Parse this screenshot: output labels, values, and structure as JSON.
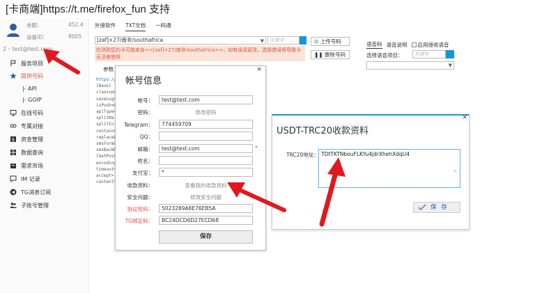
{
  "title": {
    "bracket_open": "[",
    "app_name": "卡商端",
    "bracket_close": "]",
    "url": "https://t.me/firefox_fun",
    "suffix": " 支持"
  },
  "sidebar": {
    "balance_label": "余额：",
    "balance_value": "452.4",
    "device_label": "设备ID：",
    "device_value": "8005",
    "account": "2 - test@test.com",
    "items": [
      {
        "label": "服务项目",
        "icon": "flag-icon"
      },
      {
        "label": "提供号码",
        "icon": "star-icon"
      },
      {
        "label": "在线号码",
        "icon": "screen-icon"
      },
      {
        "label": "专属对接",
        "icon": "link-icon"
      },
      {
        "label": "资金管理",
        "icon": "money-icon"
      },
      {
        "label": "数据查询",
        "icon": "grid-icon"
      },
      {
        "label": "需求市场",
        "icon": "market-icon"
      },
      {
        "label": "IM 记录",
        "icon": "chat-icon"
      },
      {
        "label": "TG消息订阅",
        "icon": "telegram-icon"
      },
      {
        "label": "子账号管理",
        "icon": "users-icon"
      }
    ],
    "sub_items": [
      "|- API",
      "|- GOIP"
    ],
    "colors": {
      "active": "#d9534f"
    }
  },
  "tabs": [
    "外接软件",
    "TXT文档",
    "一码通"
  ],
  "country_select": "[zaf]+27/南非/southafrica",
  "keyword_placeholder": "关键字",
  "warning": "检测到您的卡可能来自<<[zaf]+27/南非/southafrica>>，如有误请更改，选择错误将导致卡无法被使用",
  "upload_button": "上传号码",
  "delete_button": "删除号码",
  "voice": {
    "tab_voice_code": "语音码",
    "tab_voice_desc": "语音说明",
    "enable_label": "启用接收语音",
    "select_label": "选择语音项目：",
    "keyword_placeholder": "关键字"
  },
  "param_button": "参数",
  "code_lines": [
    "https://",
    "[Base]",
    "class=po",
    "saveLog=",
    "isPush=0",
    "apiType=",
    "splitMa",
    "splitIn",
    "contains",
    "replaceA",
    "smsForma",
    "smsBackM",
    "[GetPost",
    "encoding",
    "timeout=",
    "accept=",
    "contentT"
  ],
  "account_dialog": {
    "title": "帐号信息",
    "close": "×",
    "fields": [
      {
        "label": "帐号：",
        "value": "test@test.com"
      },
      {
        "label": "密码：",
        "text": "修改密码"
      },
      {
        "label": "Telegram：",
        "value": "774459709"
      },
      {
        "label": "QQ：",
        "value": ""
      },
      {
        "label": "邮箱：",
        "value": "test@test.com",
        "required": "*"
      },
      {
        "label": "姓名：",
        "value": ""
      },
      {
        "label": "支付宝：",
        "value": "*"
      },
      {
        "label": "收款资料：",
        "text": "查看我的收款资料"
      },
      {
        "label": "安全问题：",
        "text": "修改安全问题"
      },
      {
        "label": "协议密码：",
        "value": "5023289A8E76EB5A",
        "red": true
      },
      {
        "label": "TG绑定码：",
        "value": "BC24DCD6D27ECD68",
        "red": true
      }
    ],
    "save": "保存"
  },
  "usdt_dialog": {
    "title": "USDT-TRC20收款资料",
    "close": "×",
    "address_label": "TRC20地址：",
    "address_value": "TDtTKTNbouFLKYu4jdrXhehXdqU4",
    "clear": "×",
    "save": "保 存"
  },
  "colors": {
    "accent": "#1496d8",
    "warning_bg": "#fbe3d5",
    "warning_text": "#d9534f",
    "arrow": "#e0191e"
  }
}
